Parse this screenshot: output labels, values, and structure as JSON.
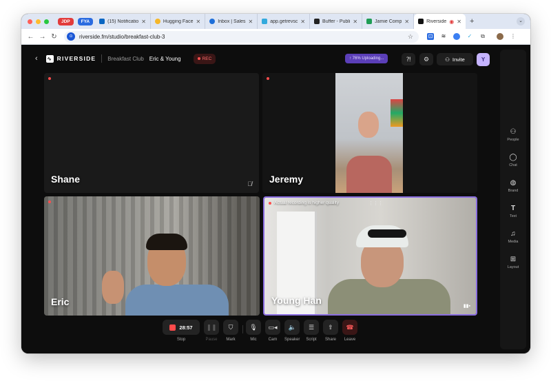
{
  "browser": {
    "tabs": [
      {
        "type": "pill",
        "label": "JDP",
        "color": "#e23b3b"
      },
      {
        "type": "pill",
        "label": "FYA",
        "color": "#2a6be0"
      },
      {
        "label": "(15) Notificatio",
        "fav_color": "#0a66c2"
      },
      {
        "label": "Hugging Face",
        "fav_color": "#f5b72a"
      },
      {
        "label": "Inbox | Sales",
        "fav_color": "#1e6fd9"
      },
      {
        "label": "app.getrevsc",
        "fav_color": "#33aadd"
      },
      {
        "label": "Buffer - Publi",
        "fav_color": "#222222"
      },
      {
        "label": "Jamie Comp",
        "fav_color": "#1f9d55"
      },
      {
        "label": "Riverside",
        "fav_color": "#111111",
        "active": true
      }
    ],
    "new_tab": "+",
    "tab_menu": "⌄",
    "url": "riverside.fm/studio/breakfast-club-3"
  },
  "app": {
    "brand": "RIVERSIDE",
    "studio_name": "Breakfast Club",
    "session_name": "Eric & Young",
    "rec_label": "REC",
    "upload_status": "76% Uploading...",
    "invite_label": "Invite",
    "user_initial": "Y"
  },
  "right_panel": [
    {
      "label": "People",
      "icon": "people-icon"
    },
    {
      "label": "Chat",
      "icon": "chat-icon"
    },
    {
      "label": "Brand",
      "icon": "palette-icon"
    },
    {
      "label": "Text",
      "icon": "text-icon"
    },
    {
      "label": "Media",
      "icon": "music-icon"
    },
    {
      "label": "Layout",
      "icon": "layout-icon"
    }
  ],
  "participants": {
    "shane": "Shane",
    "jeremy": "Jeremy",
    "eric": "Eric",
    "young": "Young Han"
  },
  "young_note": "Actual recording is higher quality",
  "controls": {
    "timer": "28:57",
    "stop": "Stop",
    "pause": "Pause",
    "mark": "Mark",
    "mic": "Mic",
    "cam": "Cam",
    "speaker": "Speaker",
    "script": "Script",
    "share": "Share",
    "leave": "Leave"
  },
  "colors": {
    "accent": "#8a6de0",
    "rec": "#ff4b4b",
    "upload_bg": "#5b3fb8"
  }
}
